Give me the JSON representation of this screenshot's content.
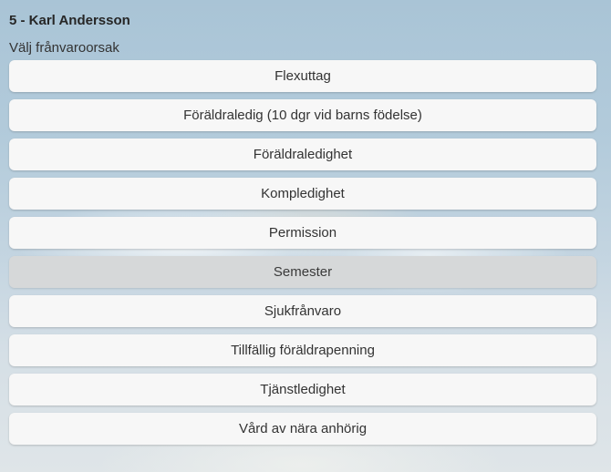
{
  "header": {
    "title": "5 - Karl Andersson",
    "subtitle": "Välj frånvaroorsak"
  },
  "reasons": [
    {
      "label": "Flexuttag",
      "selected": false
    },
    {
      "label": "Föräldraledig (10 dgr vid barns födelse)",
      "selected": false
    },
    {
      "label": "Föräldraledighet",
      "selected": false
    },
    {
      "label": "Kompledighet",
      "selected": false
    },
    {
      "label": "Permission",
      "selected": false
    },
    {
      "label": "Semester",
      "selected": true
    },
    {
      "label": "Sjukfrånvaro",
      "selected": false
    },
    {
      "label": "Tillfällig föräldrapenning",
      "selected": false
    },
    {
      "label": "Tjänstledighet",
      "selected": false
    },
    {
      "label": "Vård av nära anhörig",
      "selected": false
    }
  ],
  "colors": {
    "button_bg": "#f7f7f7",
    "button_selected_bg": "#d6d8d9",
    "text": "#333333"
  }
}
